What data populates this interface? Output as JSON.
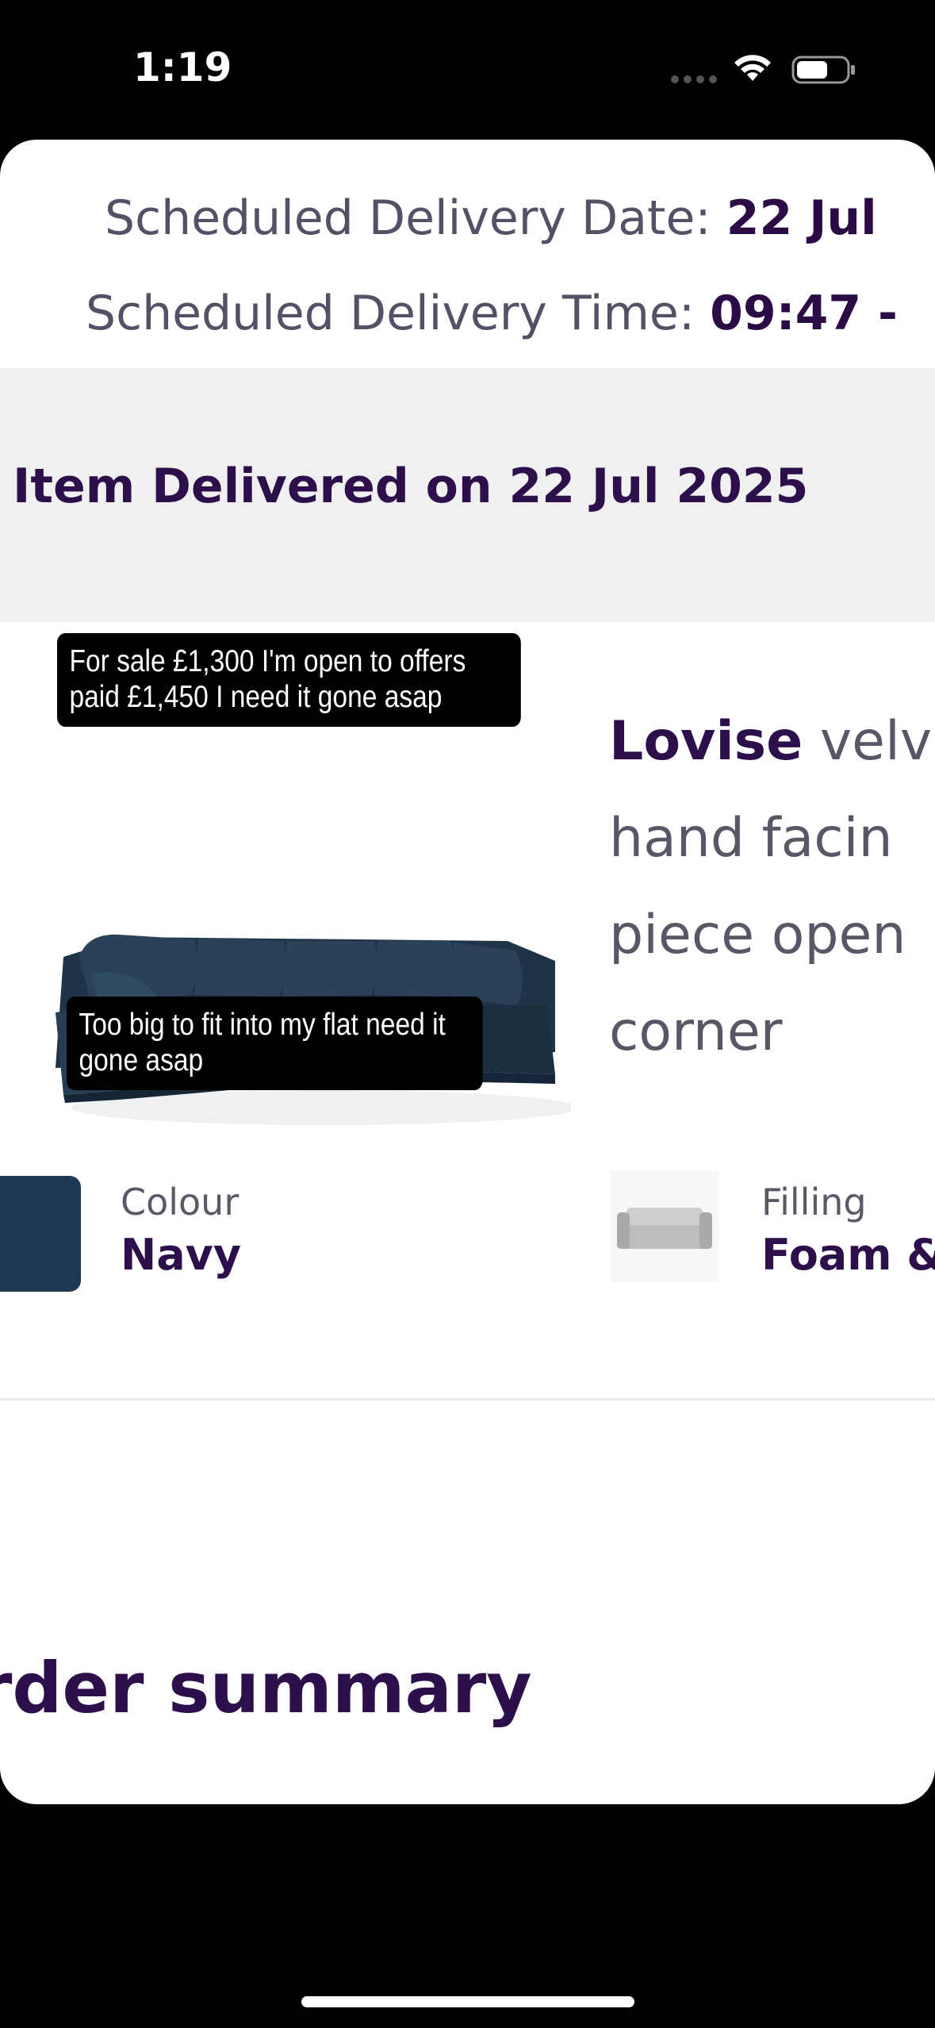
{
  "status_bar": {
    "time": "1:19"
  },
  "schedule": {
    "date_label": "Scheduled Delivery Date: ",
    "date_value": "22 Jul",
    "time_label": "Scheduled Delivery Time: ",
    "time_value": "09:47 -"
  },
  "delivery_status": "Item Delivered on 22 Jul 2025",
  "captions": {
    "top": "For sale £1,300 I'm open to offers paid £1,450 I need it gone asap",
    "bottom": "Too big to fit into my flat need it gone asap"
  },
  "product": {
    "name": "Lovise",
    "line1_rest": " velv",
    "line2": "hand facin",
    "line3": "piece open",
    "line4": "corner"
  },
  "attributes": {
    "colour_label": "Colour",
    "colour_value": "Navy",
    "colour_swatch": "#1e3a52",
    "filling_label": "Filling",
    "filling_value": "Foam &"
  },
  "order_summary_heading": "rder summary",
  "colors": {
    "brand_purple": "#2d0f4b",
    "band_grey": "#f0f0f1"
  }
}
